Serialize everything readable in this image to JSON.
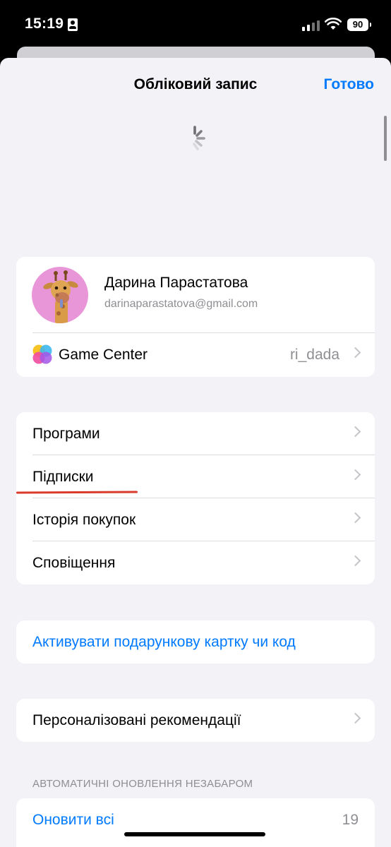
{
  "status_bar": {
    "time": "15:19",
    "battery": "90"
  },
  "nav": {
    "title": "Обліковий запис",
    "done": "Готово"
  },
  "profile": {
    "name": "Дарина Парастатова",
    "email": "darinaparastatova@gmail.com",
    "game_center_label": "Game Center",
    "game_center_value": "ri_dada"
  },
  "menu": {
    "apps": "Програми",
    "subscriptions": "Підписки",
    "purchase_history": "Історія покупок",
    "notifications": "Сповіщення"
  },
  "gift": {
    "label": "Активувати подарункову картку чи код"
  },
  "personal": {
    "label": "Персоналізовані рекомендації"
  },
  "updates": {
    "header": "АВТОМАТИЧНІ ОНОВЛЕННЯ НЕЗАБАРОМ",
    "update_all": "Оновити всі",
    "count": "19"
  },
  "colors": {
    "accent": "#007aff",
    "background": "#f2f2f7",
    "annotation": "#d93a2a"
  }
}
